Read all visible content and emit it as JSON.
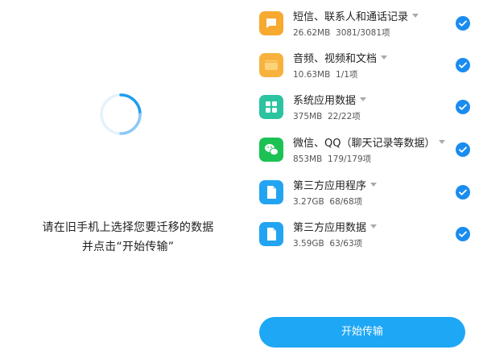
{
  "left_panel": {
    "instruction_line1": "请在旧手机上选择您要迁移的数据",
    "instruction_line2": "并点击“开始传输”"
  },
  "data_items": [
    {
      "title": "短信、联系人和通话记录",
      "size": "26.62MB",
      "count": "3081/3081项",
      "icon": "message-icon",
      "icon_color": "#f7a930"
    },
    {
      "title": "音频、视频和文档",
      "size": "10.63MB",
      "count": "1/1项",
      "icon": "folder-icon",
      "icon_color": "#f7b23d"
    },
    {
      "title": "系统应用数据",
      "size": "375MB",
      "count": "22/22项",
      "icon": "apps-grid-icon",
      "icon_color": "#2cc3a0"
    },
    {
      "title": "微信、QQ（聊天记录等数据）",
      "size": "853MB",
      "count": "179/179项",
      "icon": "wechat-icon",
      "icon_color": "#1bc253"
    },
    {
      "title": "第三方应用程序",
      "size": "3.27GB",
      "count": "68/68项",
      "icon": "document-icon",
      "icon_color": "#23a4f2"
    },
    {
      "title": "第三方应用数据",
      "size": "3.59GB",
      "count": "63/63项",
      "icon": "document-icon",
      "icon_color": "#23a4f2"
    }
  ],
  "start_button": {
    "label": "开始传输"
  },
  "colors": {
    "accent": "#1a8cf0",
    "button": "#1ea7f5"
  }
}
